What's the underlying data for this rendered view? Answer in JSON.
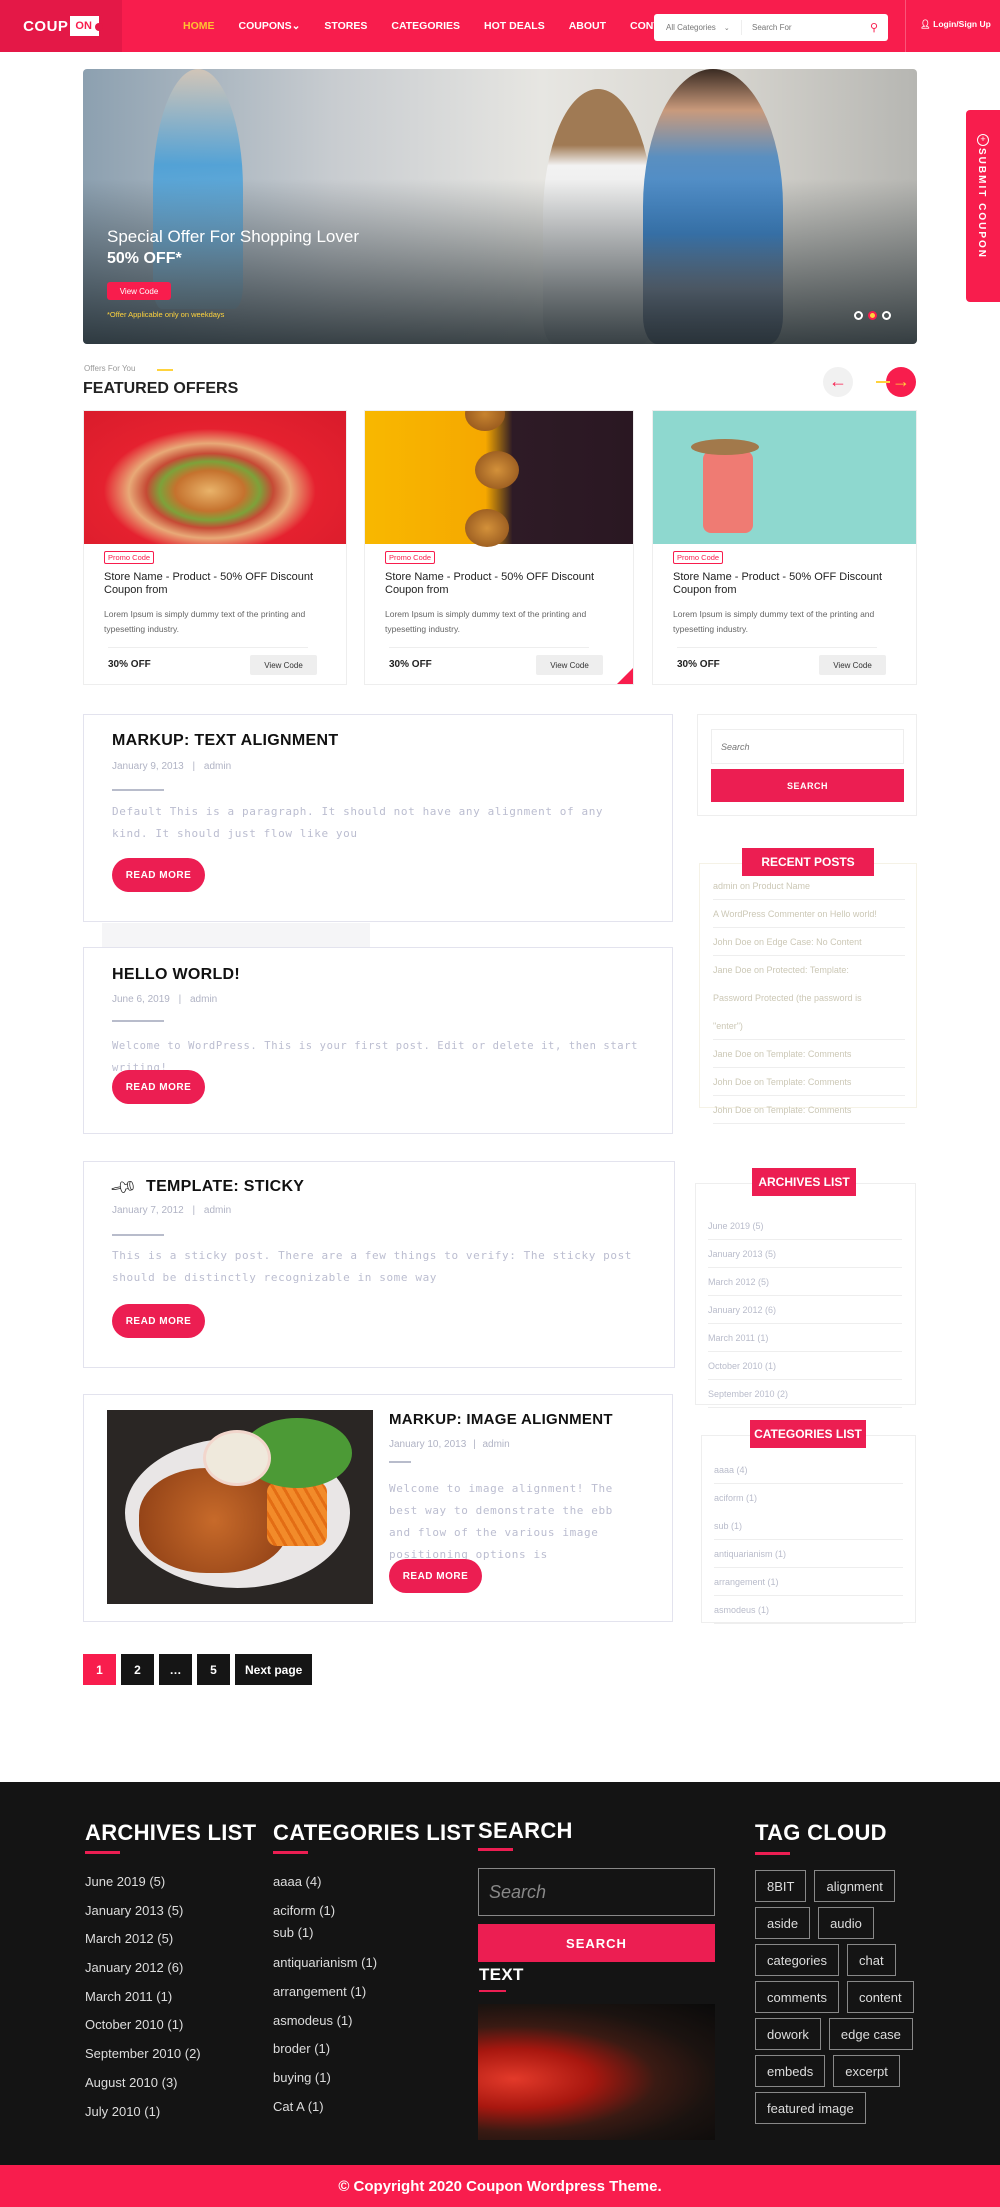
{
  "header": {
    "logo": {
      "left": "COUP",
      "right": "ON"
    },
    "nav": [
      {
        "label": "HOME",
        "active": true
      },
      {
        "label": "COUPONS⌄",
        "active": false
      },
      {
        "label": "STORES",
        "active": false
      },
      {
        "label": "CATEGORIES",
        "active": false
      },
      {
        "label": "HOT DEALS",
        "active": false
      },
      {
        "label": "ABOUT",
        "active": false
      },
      {
        "label": "CONTACT",
        "active": false
      }
    ],
    "search": {
      "category": "All Categories",
      "category_icon": "chevron-down",
      "placeholder": "Search For",
      "icon": "search"
    },
    "login": {
      "icon": "user",
      "label": "Login/Sign Up"
    }
  },
  "hero": {
    "title": "Special Offer For Shopping Lover",
    "subtitle": "50% OFF*",
    "button": "View Code",
    "note": "*Offer Applicable only on weekdays",
    "slides": 3,
    "active_slide": 2
  },
  "submit_tab": {
    "label": "SUBMIT COUPON",
    "icon": "plus-circle"
  },
  "featured": {
    "kicker": "Offers For You",
    "title": "FEATURED OFFERS",
    "prev_icon": "←",
    "next_icon": "→",
    "cards": [
      {
        "badge": "Promo Code",
        "title": "Store Name - Product - 50% OFF Discount Coupon from",
        "desc": "Lorem Ipsum is simply dummy text of the printing and typesetting industry.",
        "off": "30% OFF",
        "button": "View Code",
        "image": "burger"
      },
      {
        "badge": "Promo Code",
        "title": "Store Name - Product - 50% OFF Discount Coupon from",
        "desc": "Lorem Ipsum is simply dummy text of the printing and typesetting industry.",
        "off": "30% OFF",
        "button": "View Code",
        "image": "burgers-yellow"
      },
      {
        "badge": "Promo Code",
        "title": "Store Name - Product - 50% OFF Discount Coupon from",
        "desc": "Lorem Ipsum is simply dummy text of the printing and typesetting industry.",
        "off": "30% OFF",
        "button": "View Code",
        "image": "suitcase"
      }
    ]
  },
  "posts": [
    {
      "title": "MARKUP: TEXT ALIGNMENT",
      "date": "January 9, 2013",
      "author": "admin",
      "excerpt": "Default This is a paragraph. It should not have any alignment of any kind. It should just flow like you",
      "button": "READ MORE"
    },
    {
      "title": "HELLO WORLD!",
      "date": "June 6, 2019",
      "author": "admin",
      "excerpt": "Welcome to WordPress. This is your first post. Edit or delete it, then start writing!",
      "button": "READ MORE"
    },
    {
      "title": "TEMPLATE: STICKY",
      "date": "January 7, 2012",
      "author": "admin",
      "excerpt": "This is a sticky post. There are a few things to verify: The sticky post should be distinctly recognizable in some way",
      "button": "READ MORE",
      "icon": "pin"
    },
    {
      "title": "MARKUP: IMAGE ALIGNMENT",
      "date": "January 10, 2013",
      "author": "admin",
      "excerpt": "Welcome to image alignment! The best way to demonstrate the ebb and flow of the various image positioning options is",
      "button": "READ MORE",
      "image": "fried-chicken"
    }
  ],
  "meta_separator": "|",
  "sidebar": {
    "search": {
      "placeholder": "Search",
      "button": "SEARCH"
    },
    "recent_posts": {
      "title": "RECENT POSTS",
      "items": [
        "admin on Product Name",
        "A WordPress Commenter on Hello world!",
        "John Doe on Edge Case: No Content",
        "Jane Doe on Protected: Template:",
        "Password Protected (the password is",
        "\"enter\")",
        "Jane Doe on Template: Comments",
        "John Doe on Template: Comments",
        "John Doe on Template: Comments"
      ]
    },
    "archives": {
      "title": "ARCHIVES LIST",
      "items": [
        "June 2019 (5)",
        "January 2013 (5)",
        "March 2012 (5)",
        "January 2012 (6)",
        "March 2011 (1)",
        "October 2010 (1)",
        "September 2010 (2)"
      ]
    },
    "categories": {
      "title": "CATEGORIES LIST",
      "items": [
        "aaaa (4)",
        "aciform (1)",
        "sub (1)",
        "antiquarianism (1)",
        "arrangement (1)",
        "asmodeus (1)"
      ]
    }
  },
  "pagination": [
    {
      "label": "1",
      "active": true
    },
    {
      "label": "2",
      "active": false
    },
    {
      "label": "…",
      "active": false
    },
    {
      "label": "5",
      "active": false
    },
    {
      "label": "Next page",
      "active": false
    }
  ],
  "footer": {
    "archives": {
      "title": "ARCHIVES LIST",
      "items": [
        "June 2019 (5)",
        "January 2013 (5)",
        "March 2012 (5)",
        "January 2012 (6)",
        "March 2011 (1)",
        "October 2010 (1)",
        "September 2010 (2)",
        "August 2010 (3)",
        "July 2010 (1)"
      ]
    },
    "categories": {
      "title": "CATEGORIES LIST",
      "items": [
        "aaaa (4)",
        "aciform (1)",
        "sub (1)",
        "antiquarianism (1)",
        "arrangement (1)",
        "asmodeus (1)",
        "broder (1)",
        "buying (1)",
        "Cat A (1)"
      ]
    },
    "search": {
      "title": "SEARCH",
      "placeholder": "Search",
      "button": "SEARCH"
    },
    "text": {
      "title": "TEXT",
      "image": "red-car"
    },
    "tag_cloud": {
      "title": "TAG CLOUD",
      "tags": [
        "8BIT",
        "alignment",
        "aside",
        "audio",
        "categories",
        "chat",
        "comments",
        "content",
        "dowork",
        "edge case",
        "embeds",
        "excerpt",
        "featured image"
      ]
    },
    "copyright": "© Copyright 2020 Coupon Wordpress Theme."
  },
  "colors": {
    "brand": "#f81d4d",
    "accent": "#ffc233",
    "footer_bg": "#141414"
  }
}
